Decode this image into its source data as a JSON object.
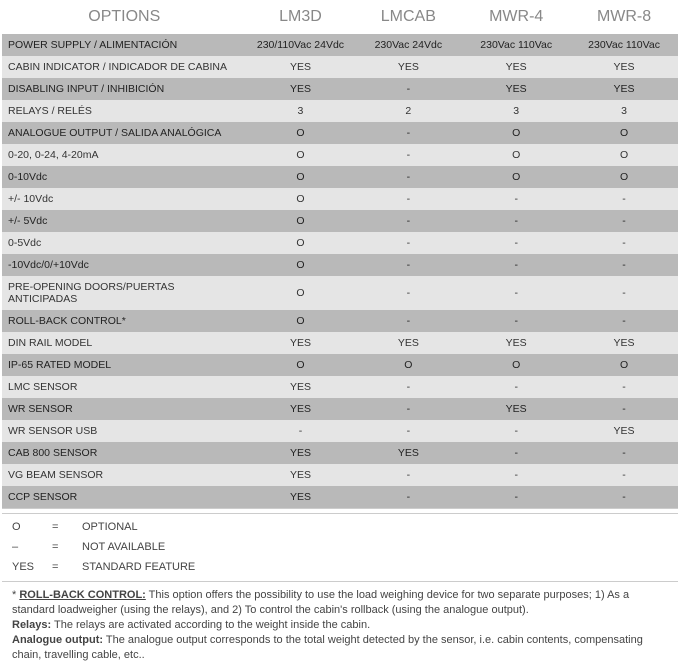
{
  "columns": [
    "LM3D",
    "LMCAB",
    "MWR-4",
    "MWR-8"
  ],
  "header_options": "OPTIONS",
  "rows": [
    {
      "label": "POWER SUPPLY / ALIMENTACIÓN",
      "vals": [
        "230/110Vac 24Vdc",
        "230Vac 24Vdc",
        "230Vac 110Vac",
        "230Vac 110Vac"
      ],
      "shade": "dark"
    },
    {
      "label": "CABIN INDICATOR / INDICADOR DE CABINA",
      "vals": [
        "YES",
        "YES",
        "YES",
        "YES"
      ],
      "shade": "light"
    },
    {
      "label": "DISABLING INPUT / INHIBICIÓN",
      "vals": [
        "YES",
        "-",
        "YES",
        "YES"
      ],
      "shade": "dark"
    },
    {
      "label": "RELAYS / RELÉS",
      "vals": [
        "3",
        "2",
        "3",
        "3"
      ],
      "shade": "light"
    },
    {
      "label": "ANALOGUE OUTPUT / SALIDA ANALÓGICA",
      "vals": [
        "O",
        "-",
        "O",
        "O"
      ],
      "shade": "dark"
    },
    {
      "label": "0-20, 0-24, 4-20mA",
      "vals": [
        "O",
        "-",
        "O",
        "O"
      ],
      "shade": "light"
    },
    {
      "label": "0-10Vdc",
      "vals": [
        "O",
        "-",
        "O",
        "O"
      ],
      "shade": "dark"
    },
    {
      "label": "+/- 10Vdc",
      "vals": [
        "O",
        "-",
        "-",
        "-"
      ],
      "shade": "light"
    },
    {
      "label": "+/- 5Vdc",
      "vals": [
        "O",
        "-",
        "-",
        "-"
      ],
      "shade": "dark"
    },
    {
      "label": "0-5Vdc",
      "vals": [
        "O",
        "-",
        "-",
        "-"
      ],
      "shade": "light"
    },
    {
      "label": "-10Vdc/0/+10Vdc",
      "vals": [
        "O",
        "-",
        "-",
        "-"
      ],
      "shade": "dark"
    },
    {
      "label": "PRE-OPENING DOORS/PUERTAS ANTICIPADAS",
      "vals": [
        "O",
        "-",
        "-",
        "-"
      ],
      "shade": "light"
    },
    {
      "label": "ROLL-BACK CONTROL*",
      "vals": [
        "O",
        "-",
        "-",
        "-"
      ],
      "shade": "dark"
    },
    {
      "label": "DIN RAIL MODEL",
      "vals": [
        "YES",
        "YES",
        "YES",
        "YES"
      ],
      "shade": "light"
    },
    {
      "label": "IP-65 RATED MODEL",
      "vals": [
        "O",
        "O",
        "O",
        "O"
      ],
      "shade": "dark"
    },
    {
      "label": "LMC SENSOR",
      "vals": [
        "YES",
        "-",
        "-",
        "-"
      ],
      "shade": "light"
    },
    {
      "label": "WR SENSOR",
      "vals": [
        "YES",
        "-",
        "YES",
        "-"
      ],
      "shade": "dark"
    },
    {
      "label": "WR SENSOR USB",
      "vals": [
        "-",
        "-",
        "-",
        "YES"
      ],
      "shade": "light"
    },
    {
      "label": "CAB 800 SENSOR",
      "vals": [
        "YES",
        "YES",
        "-",
        "-"
      ],
      "shade": "dark"
    },
    {
      "label": "VG BEAM SENSOR",
      "vals": [
        "YES",
        "-",
        "-",
        "-"
      ],
      "shade": "light"
    },
    {
      "label": "CCP SENSOR",
      "vals": [
        "YES",
        "-",
        "-",
        "-"
      ],
      "shade": "dark"
    }
  ],
  "legend": [
    {
      "sym": "O",
      "eq": "=",
      "text": "OPTIONAL"
    },
    {
      "sym": "–",
      "eq": "=",
      "text": "NOT AVAILABLE"
    },
    {
      "sym": "YES",
      "eq": "=",
      "text": "STANDARD FEATURE"
    }
  ],
  "notes": {
    "rollback_prefix": "* ",
    "rollback_title": "ROLL-BACK CONTROL:",
    "rollback_text": " This option offers the possibility to use the load weighing device for two separate purposes; 1) As a standard loadweigher (using the relays), and 2) To control the cabin's rollback (using the analogue output).",
    "relays_title": "Relays:",
    "relays_text": " The relays are activated according to the weight inside the cabin.",
    "analogue_title": "Analogue output:",
    "analogue_text": " The analogue output corresponds to the total weight detected by the sensor, i.e. cabin contents, compensating chain, travelling cable, etc.."
  }
}
